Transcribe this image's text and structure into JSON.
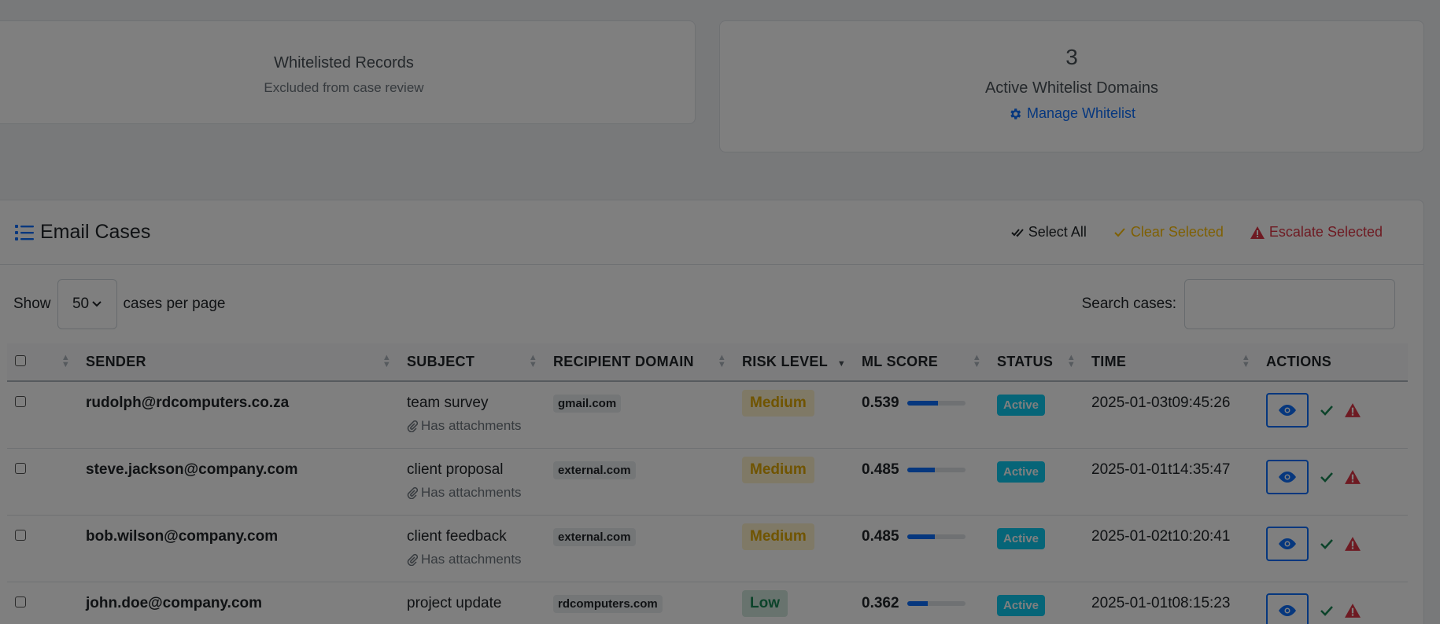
{
  "stats": {
    "whitelisted_title": "Whitelisted Records",
    "whitelisted_sub": "Excluded from case review",
    "domains_count": "3",
    "domains_title": "Active Whitelist Domains",
    "manage_link": "Manage Whitelist"
  },
  "cases": {
    "title": "Email Cases",
    "select_all": "Select All",
    "clear_selected": "Clear Selected",
    "escalate_selected": "Escalate Selected",
    "show_label": "Show",
    "per_page": "50",
    "per_page_suffix": "cases per page",
    "search_label": "Search cases:",
    "search_value": "",
    "headers": [
      "SENDER",
      "SUBJECT",
      "RECIPIENT DOMAIN",
      "RISK LEVEL",
      "ML SCORE",
      "STATUS",
      "TIME",
      "ACTIONS"
    ],
    "attach_label": "Has attachments",
    "rows": [
      {
        "sender": "rudolph@rdcomputers.co.za",
        "subject": "team survey",
        "attachments": true,
        "domain": "gmail.com",
        "risk": "Medium",
        "score": "0.539",
        "score_value": 0.539,
        "status": "Active",
        "time": "2025-01-03t09:45:26"
      },
      {
        "sender": "steve.jackson@company.com",
        "subject": "client proposal",
        "attachments": true,
        "domain": "external.com",
        "risk": "Medium",
        "score": "0.485",
        "score_value": 0.485,
        "status": "Active",
        "time": "2025-01-01t14:35:47"
      },
      {
        "sender": "bob.wilson@company.com",
        "subject": "client feedback",
        "attachments": true,
        "domain": "external.com",
        "risk": "Medium",
        "score": "0.485",
        "score_value": 0.485,
        "status": "Active",
        "time": "2025-01-02t10:20:41"
      },
      {
        "sender": "john.doe@company.com",
        "subject": "project update",
        "attachments": false,
        "domain": "rdcomputers.com",
        "risk": "Low",
        "score": "0.362",
        "score_value": 0.362,
        "status": "Active",
        "time": "2025-01-01t08:15:23"
      }
    ]
  },
  "colors": {
    "primary": "#0d6efd",
    "warning": "#ffc107",
    "danger": "#dc3545",
    "success": "#198754",
    "info": "#0dcaf0",
    "backdrop": "rgba(0,0,0,0.5)"
  }
}
